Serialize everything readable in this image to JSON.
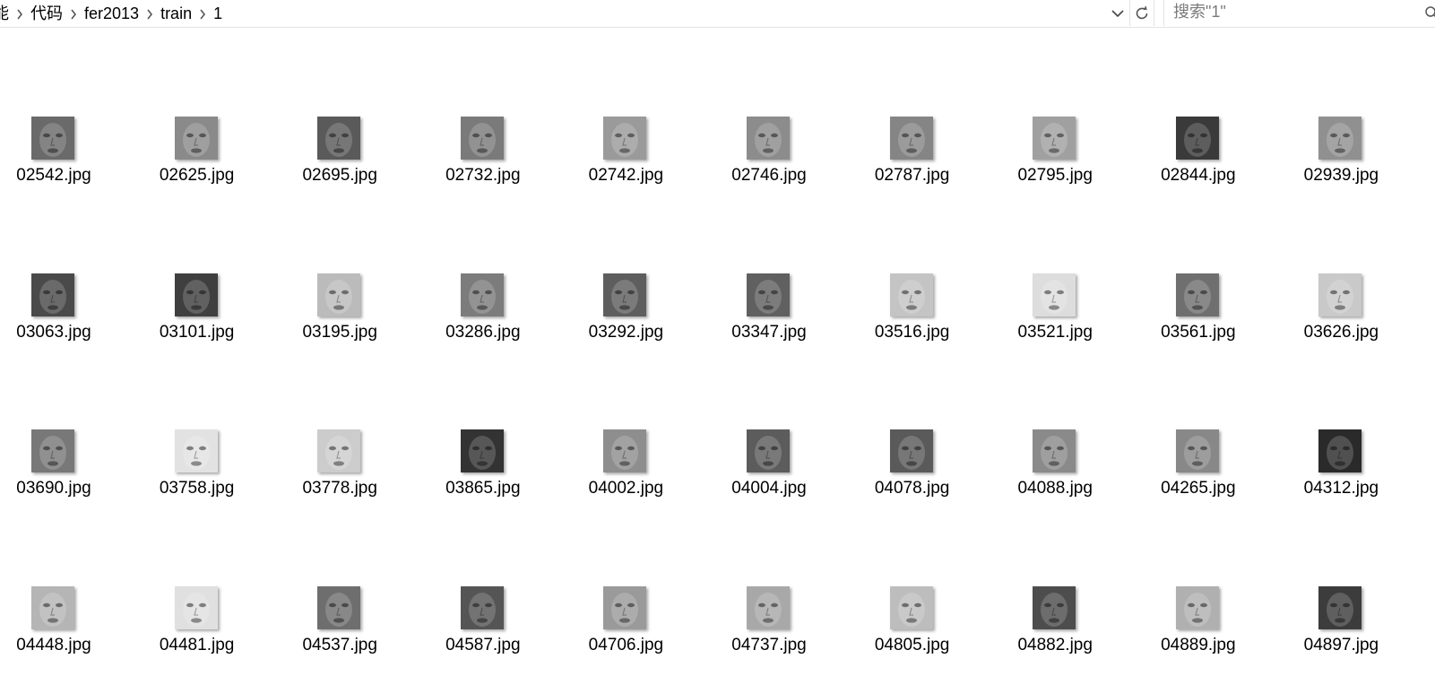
{
  "breadcrumb": {
    "items": [
      "能",
      "代码",
      "fer2013",
      "train",
      "1"
    ]
  },
  "search": {
    "placeholder": "搜索\"1\""
  },
  "icons": {
    "separator": "chevron-right-icon",
    "dropdown": "chevron-down-icon",
    "refresh": "refresh-icon",
    "search": "search-icon"
  },
  "files": [
    {
      "name": "02542.jpg",
      "tone": "#6a6a6a"
    },
    {
      "name": "02625.jpg",
      "tone": "#8a8a8a"
    },
    {
      "name": "02695.jpg",
      "tone": "#5a5a5a"
    },
    {
      "name": "02732.jpg",
      "tone": "#7a7a7a"
    },
    {
      "name": "02742.jpg",
      "tone": "#9a9a9a"
    },
    {
      "name": "02746.jpg",
      "tone": "#8c8c8c"
    },
    {
      "name": "02787.jpg",
      "tone": "#858585"
    },
    {
      "name": "02795.jpg",
      "tone": "#a0a0a0"
    },
    {
      "name": "02844.jpg",
      "tone": "#3a3a3a"
    },
    {
      "name": "02939.jpg",
      "tone": "#909090"
    },
    {
      "name": "03063.jpg",
      "tone": "#4a4a4a"
    },
    {
      "name": "03101.jpg",
      "tone": "#3f3f3f"
    },
    {
      "name": "03195.jpg",
      "tone": "#bbbbbb"
    },
    {
      "name": "03286.jpg",
      "tone": "#7c7c7c"
    },
    {
      "name": "03292.jpg",
      "tone": "#5e5e5e"
    },
    {
      "name": "03347.jpg",
      "tone": "#606060"
    },
    {
      "name": "03516.jpg",
      "tone": "#c4c4c4"
    },
    {
      "name": "03521.jpg",
      "tone": "#dddddd"
    },
    {
      "name": "03561.jpg",
      "tone": "#6f6f6f"
    },
    {
      "name": "03626.jpg",
      "tone": "#c9c9c9"
    },
    {
      "name": "03690.jpg",
      "tone": "#787878"
    },
    {
      "name": "03758.jpg",
      "tone": "#e2e2e2"
    },
    {
      "name": "03778.jpg",
      "tone": "#cccccc"
    },
    {
      "name": "03865.jpg",
      "tone": "#333333"
    },
    {
      "name": "04002.jpg",
      "tone": "#8e8e8e"
    },
    {
      "name": "04004.jpg",
      "tone": "#5c5c5c"
    },
    {
      "name": "04078.jpg",
      "tone": "#5a5a5a"
    },
    {
      "name": "04088.jpg",
      "tone": "#8a8a8a"
    },
    {
      "name": "04265.jpg",
      "tone": "#888888"
    },
    {
      "name": "04312.jpg",
      "tone": "#2a2a2a"
    },
    {
      "name": "04448.jpg",
      "tone": "#b5b5b5"
    },
    {
      "name": "04481.jpg",
      "tone": "#e0e0e0"
    },
    {
      "name": "04537.jpg",
      "tone": "#6e6e6e"
    },
    {
      "name": "04587.jpg",
      "tone": "#555555"
    },
    {
      "name": "04706.jpg",
      "tone": "#9a9a9a"
    },
    {
      "name": "04737.jpg",
      "tone": "#a8a8a8"
    },
    {
      "name": "04805.jpg",
      "tone": "#bdbdbd"
    },
    {
      "name": "04882.jpg",
      "tone": "#4d4d4d"
    },
    {
      "name": "04889.jpg",
      "tone": "#b0b0b0"
    },
    {
      "name": "04897.jpg",
      "tone": "#3c3c3c"
    }
  ]
}
